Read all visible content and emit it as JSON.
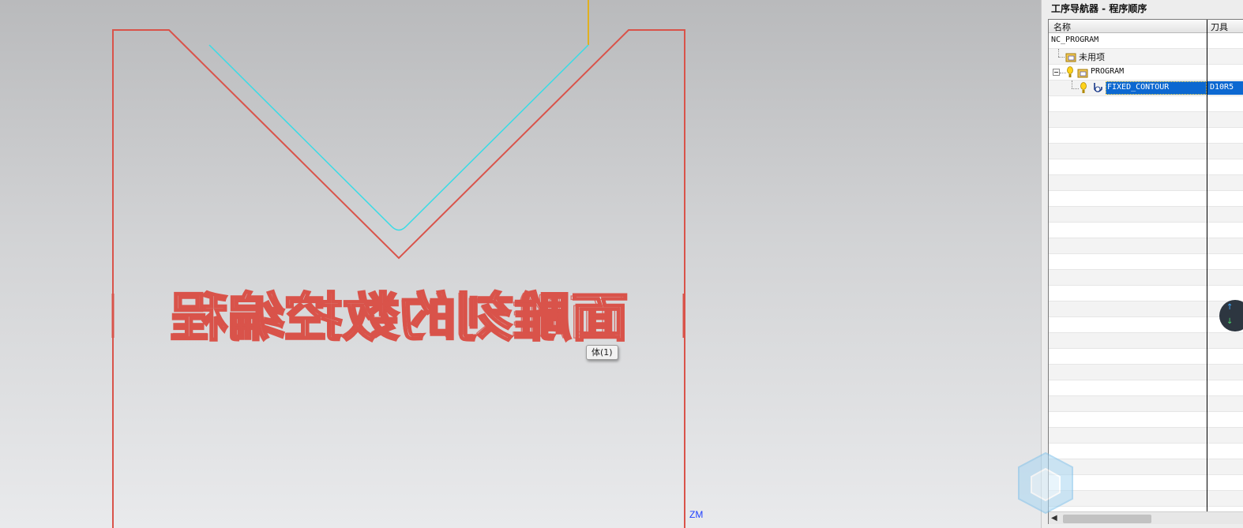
{
  "viewport": {
    "hover_tooltip": "体(1)",
    "axis_label": "ZM",
    "engraved_text": "面雕刻的数控编程",
    "colors": {
      "part_outline": "#d9534a",
      "tool_path": "#38dce6",
      "tool_axis": "#e0b020",
      "axis_label": "#1f3fff"
    }
  },
  "navigator": {
    "title": "工序导航器 - 程序顺序",
    "columns": {
      "name": "名称",
      "tool": "刀具"
    },
    "rows": [
      {
        "name": "NC_PROGRAM",
        "tool": ""
      },
      {
        "name": "未用项",
        "tool": ""
      },
      {
        "name": "PROGRAM",
        "tool": ""
      },
      {
        "name": "FIXED_CONTOUR",
        "tool": "D10R5"
      }
    ],
    "selection_color": "#0c68d1"
  }
}
